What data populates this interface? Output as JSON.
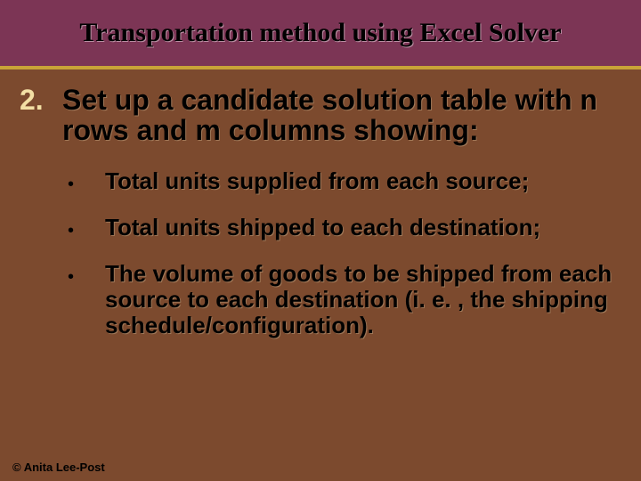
{
  "header": {
    "title": "Transportation method using Excel Solver"
  },
  "step": {
    "number": "2.",
    "text": "Set up a candidate solution table with n rows and m columns showing:"
  },
  "bullets": [
    "Total units supplied from each source;",
    "Total units shipped to each destination;",
    "The volume of goods to be shipped from each source to each destination (i. e. , the shipping schedule/configuration)."
  ],
  "footer": {
    "copyright": "© Anita Lee-Post"
  }
}
